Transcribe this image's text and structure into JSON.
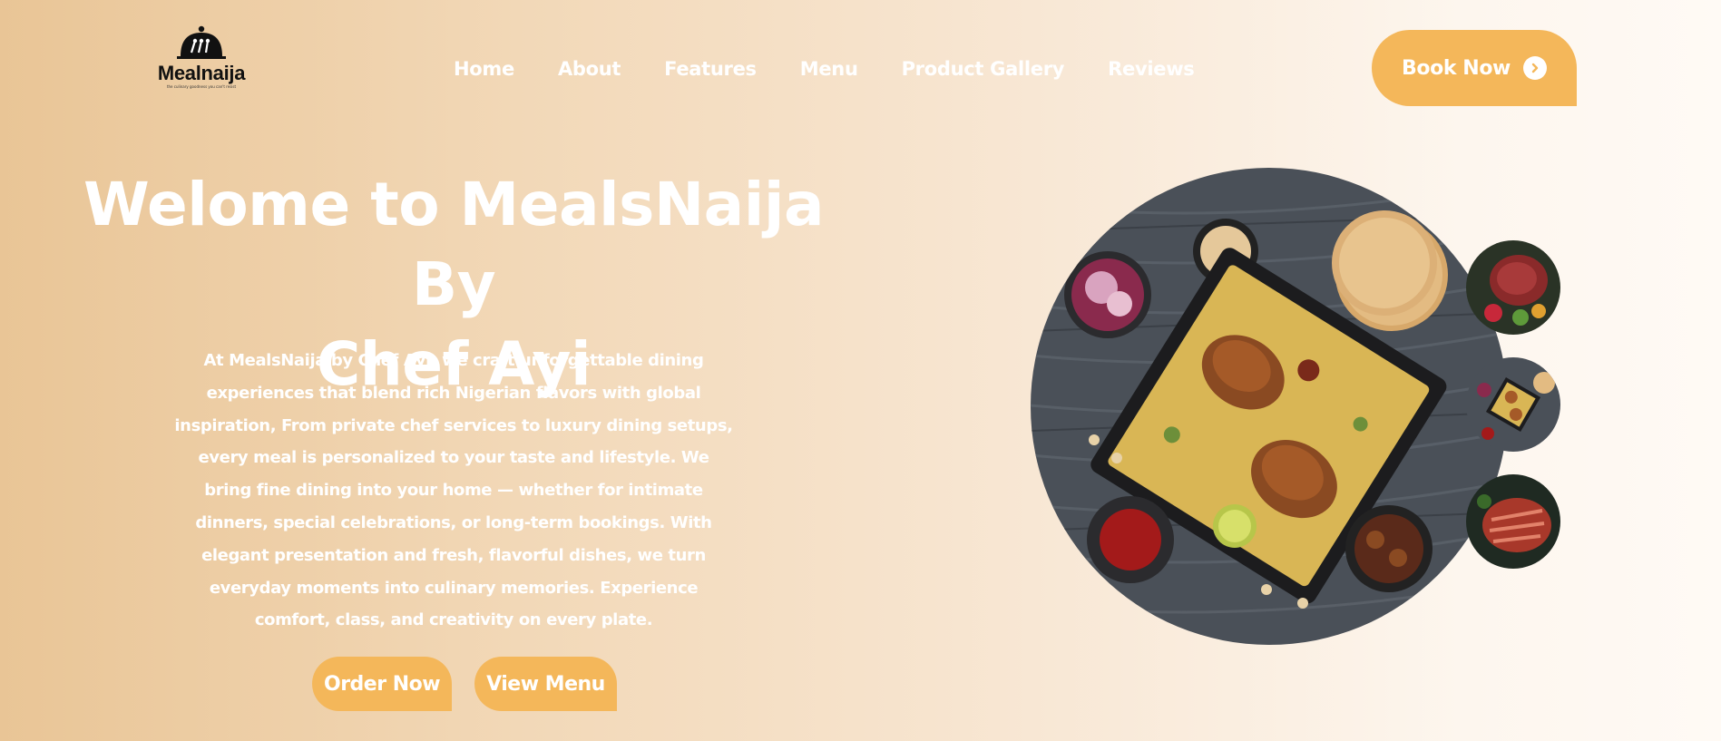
{
  "brand": {
    "name": "Mealnaija",
    "tagline": "the culinary goodness you can't resist"
  },
  "nav": [
    {
      "label": "Home"
    },
    {
      "label": "About"
    },
    {
      "label": "Features"
    },
    {
      "label": "Menu"
    },
    {
      "label": "Product Gallery"
    },
    {
      "label": "Reviews"
    }
  ],
  "header": {
    "book_label": "Book Now"
  },
  "hero": {
    "title_line1": "Welome to MealsNaija By",
    "title_line2": "Chef Ayi",
    "description": "At MealsNaija by Chef Ayi, we craft unforgettable dining experiences that blend rich Nigerian flavors with global inspiration, From private chef services to luxury dining setups, every meal is personalized to your taste and lifestyle. We bring fine dining into your home — whether for intimate dinners, special celebrations, or long-term bookings. With elegant presentation and fresh, flavorful dishes, we turn everyday moments into culinary memories. Experience comfort, class, and creativity on every plate.",
    "order_label": "Order Now",
    "view_menu_label": "View Menu"
  },
  "colors": {
    "accent": "#f4b75a",
    "text_light": "#ffffff",
    "wood": "#4a5058"
  }
}
